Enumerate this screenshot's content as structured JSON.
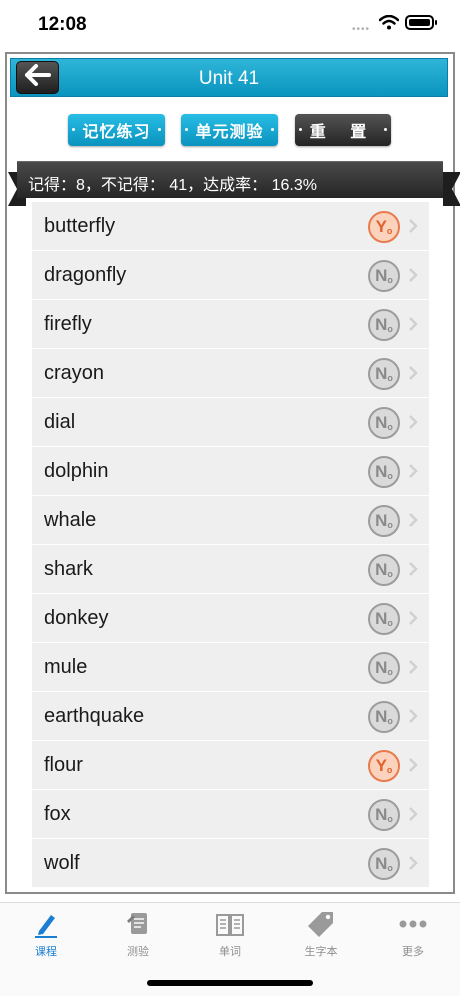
{
  "status_bar": {
    "time": "12:08"
  },
  "header": {
    "title": "Unit 41"
  },
  "buttons": {
    "memory_practice": "记忆练习",
    "unit_test": "单元测验",
    "reset": "重 置"
  },
  "stats": {
    "text": "记得：8，不记得： 41，达成率： 16.3%"
  },
  "words": [
    {
      "word": "butterfly",
      "status": "yes",
      "mark": "Y"
    },
    {
      "word": "dragonfly",
      "status": "no",
      "mark": "N"
    },
    {
      "word": "firefly",
      "status": "no",
      "mark": "N"
    },
    {
      "word": "crayon",
      "status": "no",
      "mark": "N"
    },
    {
      "word": "dial",
      "status": "no",
      "mark": "N"
    },
    {
      "word": "dolphin",
      "status": "no",
      "mark": "N"
    },
    {
      "word": "whale",
      "status": "no",
      "mark": "N"
    },
    {
      "word": "shark",
      "status": "no",
      "mark": "N"
    },
    {
      "word": "donkey",
      "status": "no",
      "mark": "N"
    },
    {
      "word": "mule",
      "status": "no",
      "mark": "N"
    },
    {
      "word": "earthquake",
      "status": "no",
      "mark": "N"
    },
    {
      "word": "flour",
      "status": "yes",
      "mark": "Y"
    },
    {
      "word": "fox",
      "status": "no",
      "mark": "N"
    },
    {
      "word": "wolf",
      "status": "no",
      "mark": "N"
    }
  ],
  "tabs": [
    {
      "label": "课程",
      "icon": "pencil-icon",
      "active": true
    },
    {
      "label": "测验",
      "icon": "quiz-icon",
      "active": false
    },
    {
      "label": "单词",
      "icon": "book-icon",
      "active": false
    },
    {
      "label": "生字本",
      "icon": "tag-icon",
      "active": false
    },
    {
      "label": "更多",
      "icon": "more-icon",
      "active": false
    }
  ],
  "colors": {
    "accent": "#0a95bf",
    "active_tab": "#1a7fd3",
    "yes_mark": "#e0622f",
    "no_mark": "#9c9c9c"
  }
}
